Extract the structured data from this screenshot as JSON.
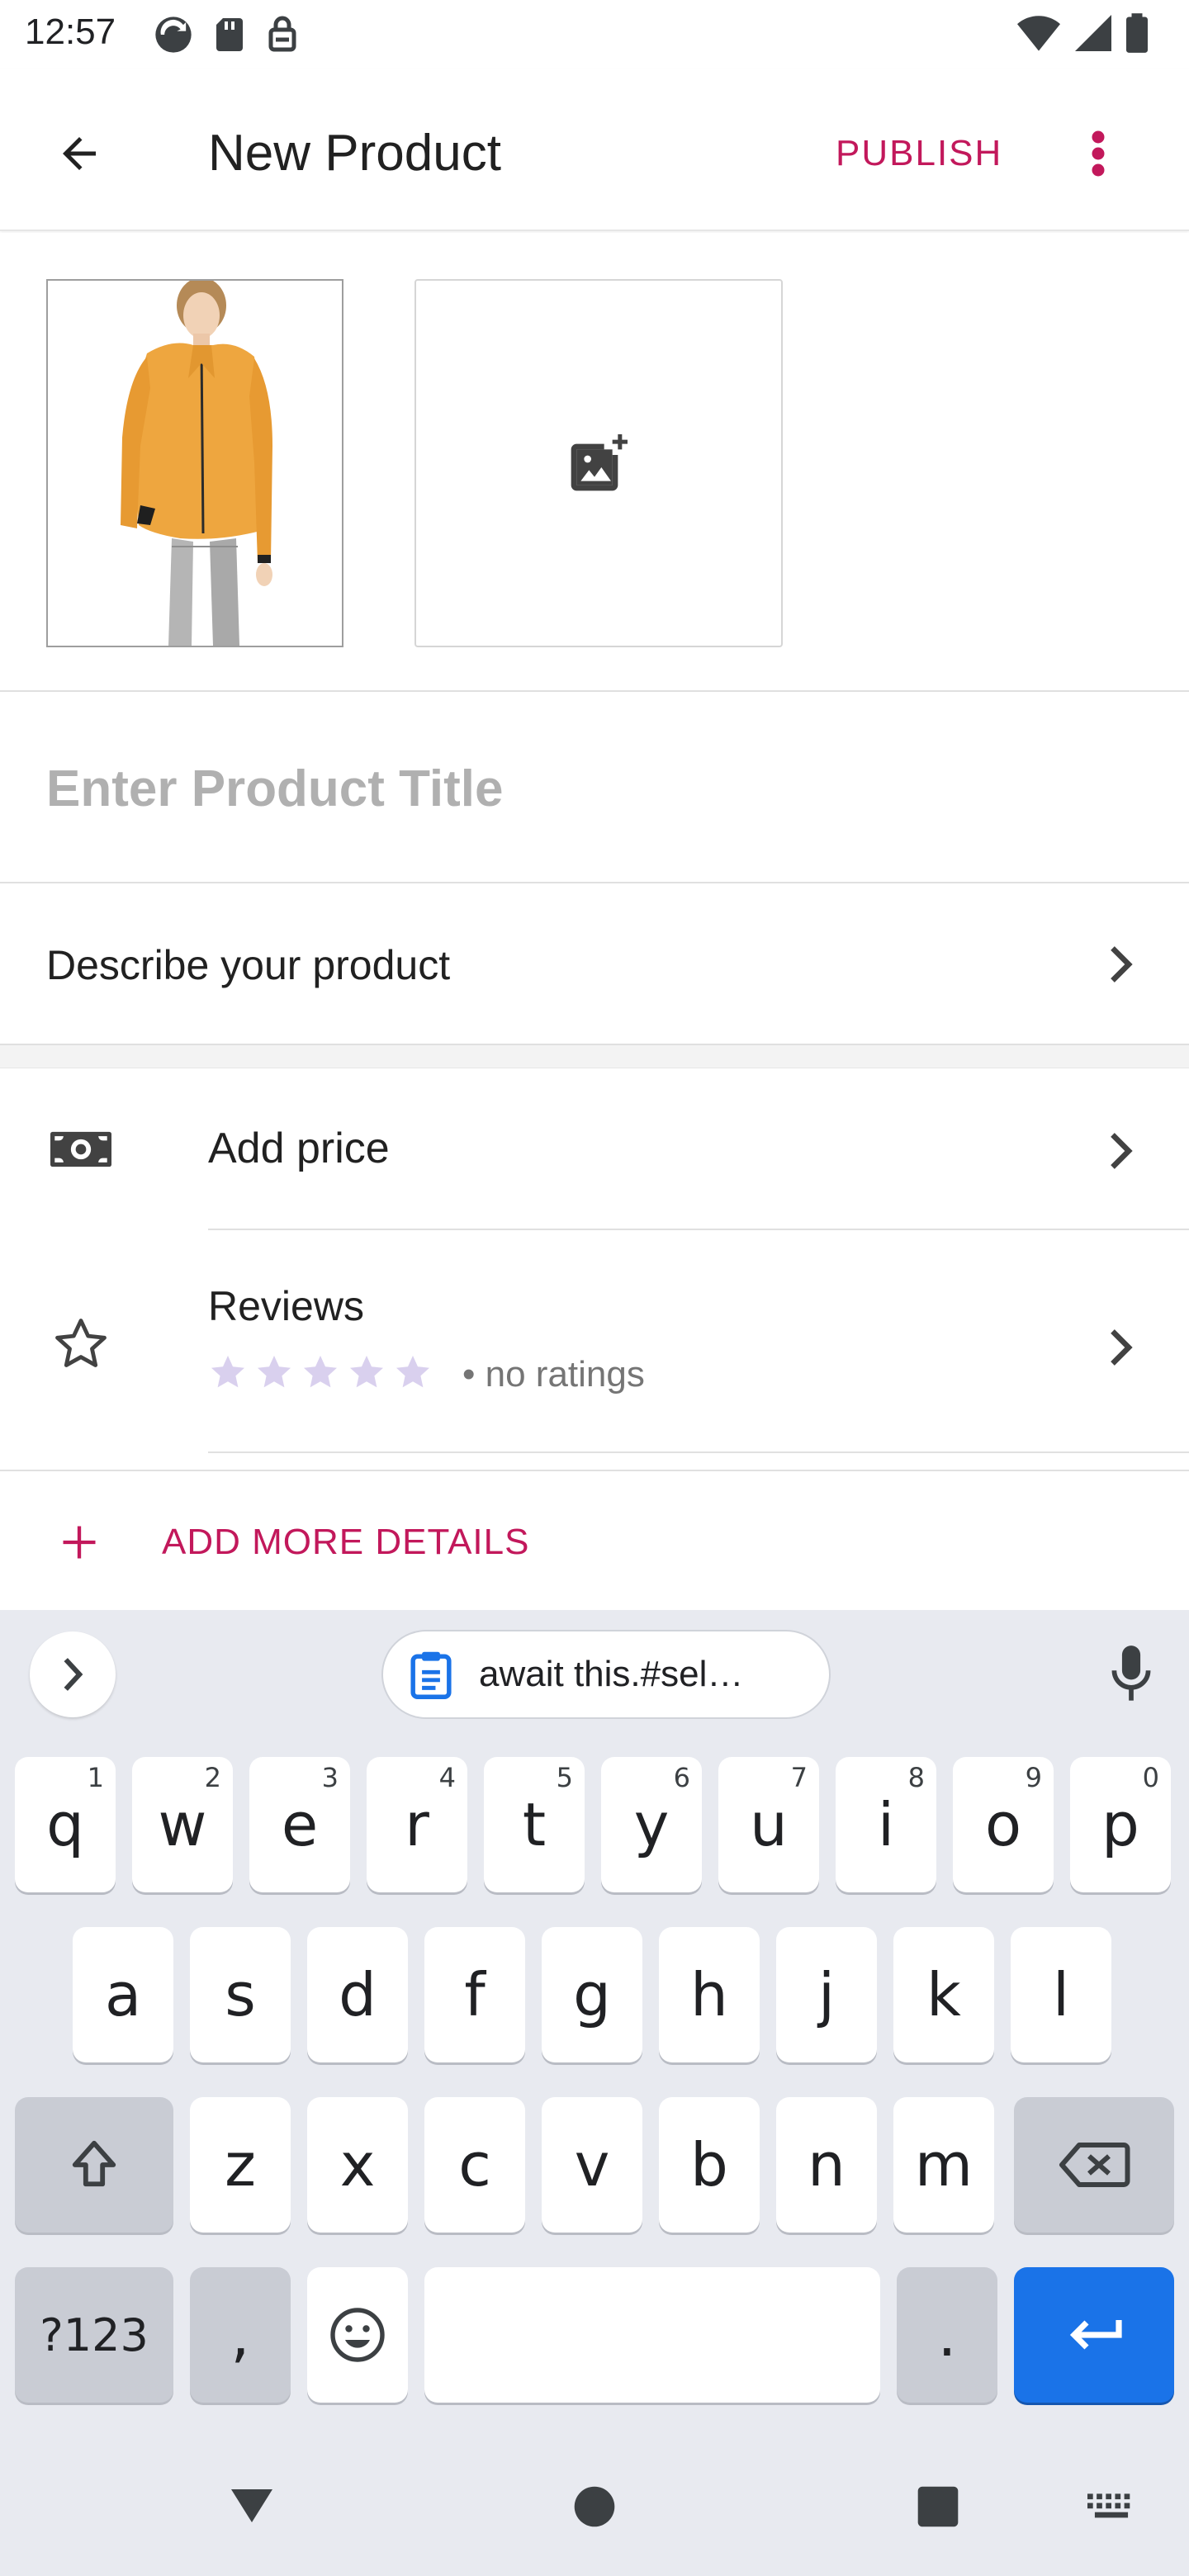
{
  "status_bar": {
    "time": "12:57"
  },
  "app_bar": {
    "title": "New Product",
    "publish_label": "PUBLISH"
  },
  "product_form": {
    "title_placeholder": "Enter Product Title",
    "description_label": "Describe your product",
    "price_label": "Add price",
    "reviews_label": "Reviews",
    "rating_note": "• no ratings",
    "add_more_label": "ADD MORE DETAILS"
  },
  "keyboard": {
    "clipboard_suggestion": "await this.#sel…",
    "row1": [
      {
        "key": "q",
        "hint": "1"
      },
      {
        "key": "w",
        "hint": "2"
      },
      {
        "key": "e",
        "hint": "3"
      },
      {
        "key": "r",
        "hint": "4"
      },
      {
        "key": "t",
        "hint": "5"
      },
      {
        "key": "y",
        "hint": "6"
      },
      {
        "key": "u",
        "hint": "7"
      },
      {
        "key": "i",
        "hint": "8"
      },
      {
        "key": "o",
        "hint": "9"
      },
      {
        "key": "p",
        "hint": "0"
      }
    ],
    "row2": [
      "a",
      "s",
      "d",
      "f",
      "g",
      "h",
      "j",
      "k",
      "l"
    ],
    "row3": [
      "z",
      "x",
      "c",
      "v",
      "b",
      "n",
      "m"
    ],
    "symbols_label": "?123",
    "comma_label": ",",
    "period_label": "."
  },
  "colors": {
    "accent": "#c2185b",
    "keyboard_bg": "#e8eaf0",
    "enter_key": "#1a73e8",
    "star_empty": "#d1c4e9"
  },
  "icons": {
    "back": "arrow-left-icon",
    "overflow": "more-vert-icon",
    "add_image": "add-photo-icon",
    "price": "money-icon",
    "reviews": "star-outline-icon",
    "add_more": "plus-icon"
  }
}
